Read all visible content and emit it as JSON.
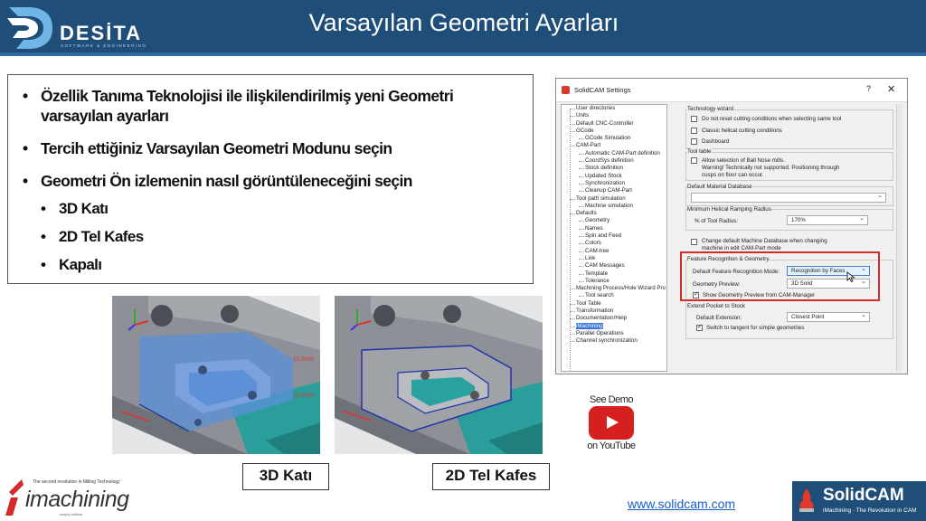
{
  "header": {
    "title": "Varsayılan Geometri Ayarları",
    "logo_text": "DESİTA",
    "logo_tagline": "SOFTWARE & ENGINEERING"
  },
  "bullets": {
    "items": [
      "Özellik Tanıma Teknolojisi ile ilişkilendirilmiş yeni Geometri varsayılan ayarları",
      "Tercih ettiğiniz Varsayılan Geometri Modunu seçin",
      "Geometri Ön izlemenin nasıl görüntüleneceğini seçin"
    ],
    "sub_items": [
      "3D Katı",
      "2D Tel Kafes",
      "Kapalı"
    ]
  },
  "images": {
    "solid_caption": "3D Katı",
    "wire_caption": "2D Tel Kafes",
    "dim_label_1": "10.0000",
    "dim_label_2": "10.0000"
  },
  "dialog": {
    "title": "SolidCAM Settings",
    "help": "?",
    "close": "✕",
    "tree": [
      {
        "label": "User directories",
        "level": 0
      },
      {
        "label": "Units",
        "level": 0
      },
      {
        "label": "Default CNC-Controller",
        "level": 0
      },
      {
        "label": "GCode",
        "level": 0
      },
      {
        "label": "GCode Simulation",
        "level": 1
      },
      {
        "label": "CAM-Part",
        "level": 0
      },
      {
        "label": "Automatic CAM-Part definition",
        "level": 1
      },
      {
        "label": "CoordSys definition",
        "level": 1
      },
      {
        "label": "Stock definition",
        "level": 1
      },
      {
        "label": "Updated Stock",
        "level": 1
      },
      {
        "label": "Synchronization",
        "level": 1
      },
      {
        "label": "Cleanup CAM-Part",
        "level": 1
      },
      {
        "label": "Tool path simulation",
        "level": 0
      },
      {
        "label": "Machine simulation",
        "level": 1
      },
      {
        "label": "Defaults",
        "level": 0
      },
      {
        "label": "Geometry",
        "level": 1
      },
      {
        "label": "Names",
        "level": 1
      },
      {
        "label": "Spin and Feed",
        "level": 1
      },
      {
        "label": "Colors",
        "level": 1
      },
      {
        "label": "CAM-tree",
        "level": 1
      },
      {
        "label": "Link",
        "level": 1
      },
      {
        "label": "CAM Messages",
        "level": 1
      },
      {
        "label": "Template",
        "level": 1
      },
      {
        "label": "Tolerance",
        "level": 1
      },
      {
        "label": "Machining Process/Hole Wizard Pro",
        "level": 0
      },
      {
        "label": "Tool search",
        "level": 1
      },
      {
        "label": "Tool Table",
        "level": 0
      },
      {
        "label": "Transformation",
        "level": 0
      },
      {
        "label": "Documentation/Help",
        "level": 0
      },
      {
        "label": "iMachining",
        "level": 0,
        "selected": true
      },
      {
        "label": "Parallel Operations",
        "level": 0
      },
      {
        "label": "Channel synchronization",
        "level": 0
      }
    ],
    "technology_wizard": {
      "title": "Technology wizard",
      "opt1": "Do not reset cutting conditions when selecting same tool",
      "opt2": "Classic helical cutting conditions",
      "opt3": "Dashboard"
    },
    "tool_table": {
      "title": "Tool table",
      "opt1_line1": "Allow selection of Ball Nose mills.",
      "opt1_line2": "Warning! Technically not supported. Positioning through",
      "opt1_line3": "cusps on floor can occur."
    },
    "machine_db": {
      "title": "Default Material Database",
      "value": ""
    },
    "ramping": {
      "title": "Minimum Helical Ramping Radius",
      "label": "% of Tool Radius:",
      "value": "170%"
    },
    "change_db": {
      "line1": "Change default Machine Database when changing",
      "line2": "machine in edit CAM-Part mode"
    },
    "feature": {
      "title": "Feature Recognition & Geometry",
      "mode_label": "Default Feature Recognition Mode:",
      "mode_value": "Recognition by Faces",
      "preview_label": "Geometry Preview:",
      "preview_value": "3D Solid",
      "show_preview": "Show Geometry Preview from CAM-Manager"
    },
    "extend": {
      "title": "Extend Pocket to Stock",
      "ext_label": "Default Extension:",
      "ext_value": "Closest Point",
      "switch_label": "Switch to tangent for simple geometries"
    }
  },
  "youtube": {
    "see_demo": "See Demo",
    "on_youtube": "on YouTube"
  },
  "footer": {
    "imachining_tagline": "The second revolution in Milling Technology",
    "imachining_name": "imachining",
    "imachining_sub": "simply brilliant",
    "url": "www.solidcam.com",
    "solidcam_name": "SolidCAM",
    "solidcam_tagline": "iMachining · The Revolution in CAM"
  },
  "colors": {
    "header_bg": "#1f4e79",
    "highlight_red": "#d42a2a",
    "link_blue": "#1a5fc4",
    "youtube_red": "#d61f1f"
  }
}
